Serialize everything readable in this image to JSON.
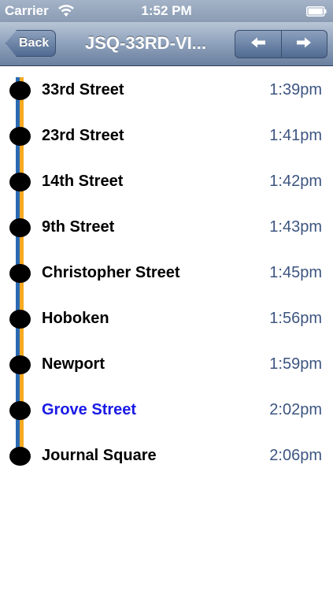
{
  "status_bar": {
    "carrier": "Carrier",
    "time": "1:52 PM",
    "wifi_icon": "wifi-icon",
    "battery_icon": "battery-icon"
  },
  "nav_bar": {
    "back_label": "Back",
    "title": "JSQ-33RD-VI...",
    "prev_icon": "arrow-left-icon",
    "next_icon": "arrow-right-icon"
  },
  "colors": {
    "route_line_blue": "#2a6ab3",
    "route_line_orange": "#f6aa22",
    "current_stop": "#1a1ae6",
    "time_text": "#3d5580"
  },
  "stops": [
    {
      "name": "33rd Street",
      "time": "1:39pm",
      "current": false
    },
    {
      "name": "23rd Street",
      "time": "1:41pm",
      "current": false
    },
    {
      "name": "14th Street",
      "time": "1:42pm",
      "current": false
    },
    {
      "name": "9th Street",
      "time": "1:43pm",
      "current": false
    },
    {
      "name": "Christopher Street",
      "time": "1:45pm",
      "current": false
    },
    {
      "name": "Hoboken",
      "time": "1:56pm",
      "current": false
    },
    {
      "name": "Newport",
      "time": "1:59pm",
      "current": false
    },
    {
      "name": "Grove Street",
      "time": "2:02pm",
      "current": true
    },
    {
      "name": "Journal Square",
      "time": "2:06pm",
      "current": false
    }
  ]
}
